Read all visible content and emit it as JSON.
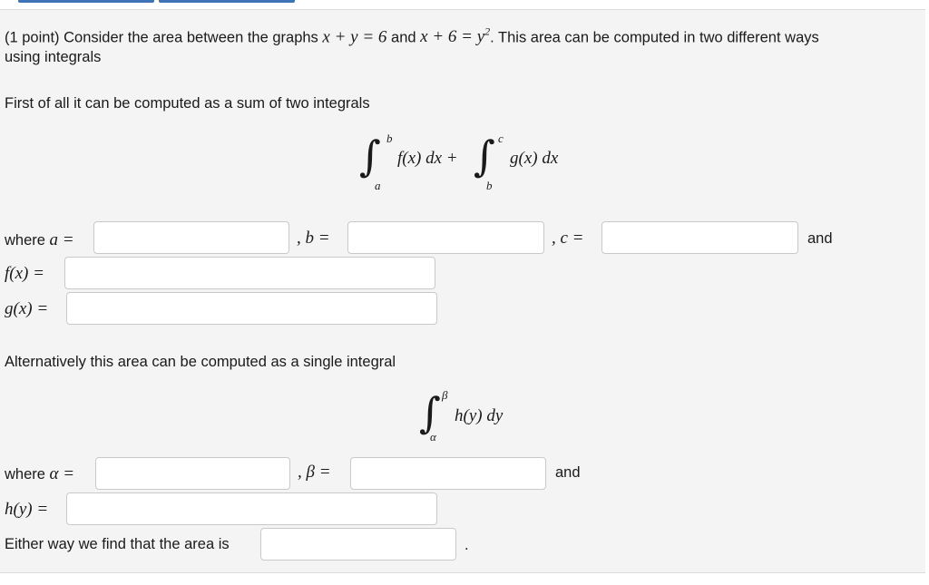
{
  "question": {
    "prefix": "(1 point) Consider the area between the graphs",
    "eq1": "x + y = 6",
    "and1": "and",
    "eq2_main": "x + 6 = y",
    "eq2_exp": "2",
    "suffix": ". This area can be computed in two different ways",
    "line2": "using integrals"
  },
  "part1": {
    "intro": "First of all it can be computed as a sum of two integrals",
    "int1_lower": "a",
    "int1_upper": "b",
    "int1_expr": "f(x) dx +",
    "int2_lower": "b",
    "int2_upper": "c",
    "int2_expr": "g(x) dx",
    "where_label": "where",
    "a_label": "a =",
    "b_label": ", b =",
    "c_label": ", c =",
    "and_label": "and",
    "f_label": "f(x) =",
    "g_label": "g(x) ="
  },
  "part2": {
    "intro": "Alternatively this area can be computed as a single integral",
    "int_lower": "α",
    "int_upper": "β",
    "int_expr": "h(y) dy",
    "where_label": "where",
    "alpha_label": "α =",
    "beta_label": ", β =",
    "and_label": "and",
    "h_label": "h(y) ="
  },
  "conclusion": {
    "text": "Either way we find that the area is",
    "period": "."
  },
  "inputs": {
    "a": "",
    "b": "",
    "c": "",
    "f": "",
    "g": "",
    "alpha": "",
    "beta": "",
    "h": "",
    "area": ""
  },
  "colors": {
    "panel_bg": "#f4f4f4",
    "tab_accent": "#3f73b8",
    "input_border": "#c9c9c9"
  }
}
